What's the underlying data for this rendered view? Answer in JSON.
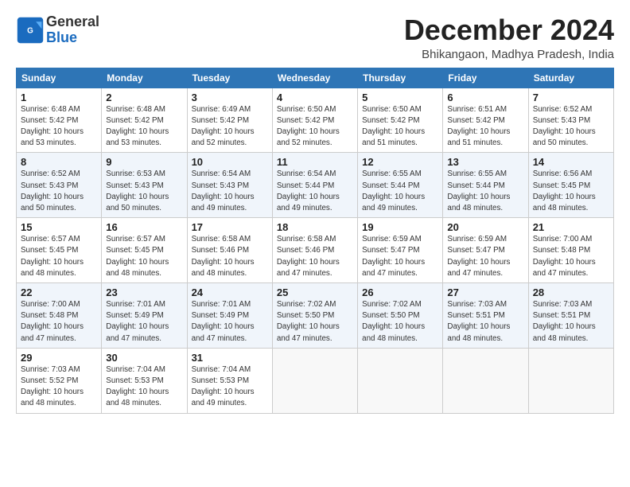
{
  "header": {
    "logo_general": "General",
    "logo_blue": "Blue",
    "title": "December 2024",
    "location": "Bhikangaon, Madhya Pradesh, India"
  },
  "days_of_week": [
    "Sunday",
    "Monday",
    "Tuesday",
    "Wednesday",
    "Thursday",
    "Friday",
    "Saturday"
  ],
  "weeks": [
    [
      {
        "day": "1",
        "detail": "Sunrise: 6:48 AM\nSunset: 5:42 PM\nDaylight: 10 hours\nand 53 minutes."
      },
      {
        "day": "2",
        "detail": "Sunrise: 6:48 AM\nSunset: 5:42 PM\nDaylight: 10 hours\nand 53 minutes."
      },
      {
        "day": "3",
        "detail": "Sunrise: 6:49 AM\nSunset: 5:42 PM\nDaylight: 10 hours\nand 52 minutes."
      },
      {
        "day": "4",
        "detail": "Sunrise: 6:50 AM\nSunset: 5:42 PM\nDaylight: 10 hours\nand 52 minutes."
      },
      {
        "day": "5",
        "detail": "Sunrise: 6:50 AM\nSunset: 5:42 PM\nDaylight: 10 hours\nand 51 minutes."
      },
      {
        "day": "6",
        "detail": "Sunrise: 6:51 AM\nSunset: 5:42 PM\nDaylight: 10 hours\nand 51 minutes."
      },
      {
        "day": "7",
        "detail": "Sunrise: 6:52 AM\nSunset: 5:43 PM\nDaylight: 10 hours\nand 50 minutes."
      }
    ],
    [
      {
        "day": "8",
        "detail": "Sunrise: 6:52 AM\nSunset: 5:43 PM\nDaylight: 10 hours\nand 50 minutes."
      },
      {
        "day": "9",
        "detail": "Sunrise: 6:53 AM\nSunset: 5:43 PM\nDaylight: 10 hours\nand 50 minutes."
      },
      {
        "day": "10",
        "detail": "Sunrise: 6:54 AM\nSunset: 5:43 PM\nDaylight: 10 hours\nand 49 minutes."
      },
      {
        "day": "11",
        "detail": "Sunrise: 6:54 AM\nSunset: 5:44 PM\nDaylight: 10 hours\nand 49 minutes."
      },
      {
        "day": "12",
        "detail": "Sunrise: 6:55 AM\nSunset: 5:44 PM\nDaylight: 10 hours\nand 49 minutes."
      },
      {
        "day": "13",
        "detail": "Sunrise: 6:55 AM\nSunset: 5:44 PM\nDaylight: 10 hours\nand 48 minutes."
      },
      {
        "day": "14",
        "detail": "Sunrise: 6:56 AM\nSunset: 5:45 PM\nDaylight: 10 hours\nand 48 minutes."
      }
    ],
    [
      {
        "day": "15",
        "detail": "Sunrise: 6:57 AM\nSunset: 5:45 PM\nDaylight: 10 hours\nand 48 minutes."
      },
      {
        "day": "16",
        "detail": "Sunrise: 6:57 AM\nSunset: 5:45 PM\nDaylight: 10 hours\nand 48 minutes."
      },
      {
        "day": "17",
        "detail": "Sunrise: 6:58 AM\nSunset: 5:46 PM\nDaylight: 10 hours\nand 48 minutes."
      },
      {
        "day": "18",
        "detail": "Sunrise: 6:58 AM\nSunset: 5:46 PM\nDaylight: 10 hours\nand 47 minutes."
      },
      {
        "day": "19",
        "detail": "Sunrise: 6:59 AM\nSunset: 5:47 PM\nDaylight: 10 hours\nand 47 minutes."
      },
      {
        "day": "20",
        "detail": "Sunrise: 6:59 AM\nSunset: 5:47 PM\nDaylight: 10 hours\nand 47 minutes."
      },
      {
        "day": "21",
        "detail": "Sunrise: 7:00 AM\nSunset: 5:48 PM\nDaylight: 10 hours\nand 47 minutes."
      }
    ],
    [
      {
        "day": "22",
        "detail": "Sunrise: 7:00 AM\nSunset: 5:48 PM\nDaylight: 10 hours\nand 47 minutes."
      },
      {
        "day": "23",
        "detail": "Sunrise: 7:01 AM\nSunset: 5:49 PM\nDaylight: 10 hours\nand 47 minutes."
      },
      {
        "day": "24",
        "detail": "Sunrise: 7:01 AM\nSunset: 5:49 PM\nDaylight: 10 hours\nand 47 minutes."
      },
      {
        "day": "25",
        "detail": "Sunrise: 7:02 AM\nSunset: 5:50 PM\nDaylight: 10 hours\nand 47 minutes."
      },
      {
        "day": "26",
        "detail": "Sunrise: 7:02 AM\nSunset: 5:50 PM\nDaylight: 10 hours\nand 48 minutes."
      },
      {
        "day": "27",
        "detail": "Sunrise: 7:03 AM\nSunset: 5:51 PM\nDaylight: 10 hours\nand 48 minutes."
      },
      {
        "day": "28",
        "detail": "Sunrise: 7:03 AM\nSunset: 5:51 PM\nDaylight: 10 hours\nand 48 minutes."
      }
    ],
    [
      {
        "day": "29",
        "detail": "Sunrise: 7:03 AM\nSunset: 5:52 PM\nDaylight: 10 hours\nand 48 minutes."
      },
      {
        "day": "30",
        "detail": "Sunrise: 7:04 AM\nSunset: 5:53 PM\nDaylight: 10 hours\nand 48 minutes."
      },
      {
        "day": "31",
        "detail": "Sunrise: 7:04 AM\nSunset: 5:53 PM\nDaylight: 10 hours\nand 49 minutes."
      },
      {
        "day": "",
        "detail": ""
      },
      {
        "day": "",
        "detail": ""
      },
      {
        "day": "",
        "detail": ""
      },
      {
        "day": "",
        "detail": ""
      }
    ]
  ]
}
